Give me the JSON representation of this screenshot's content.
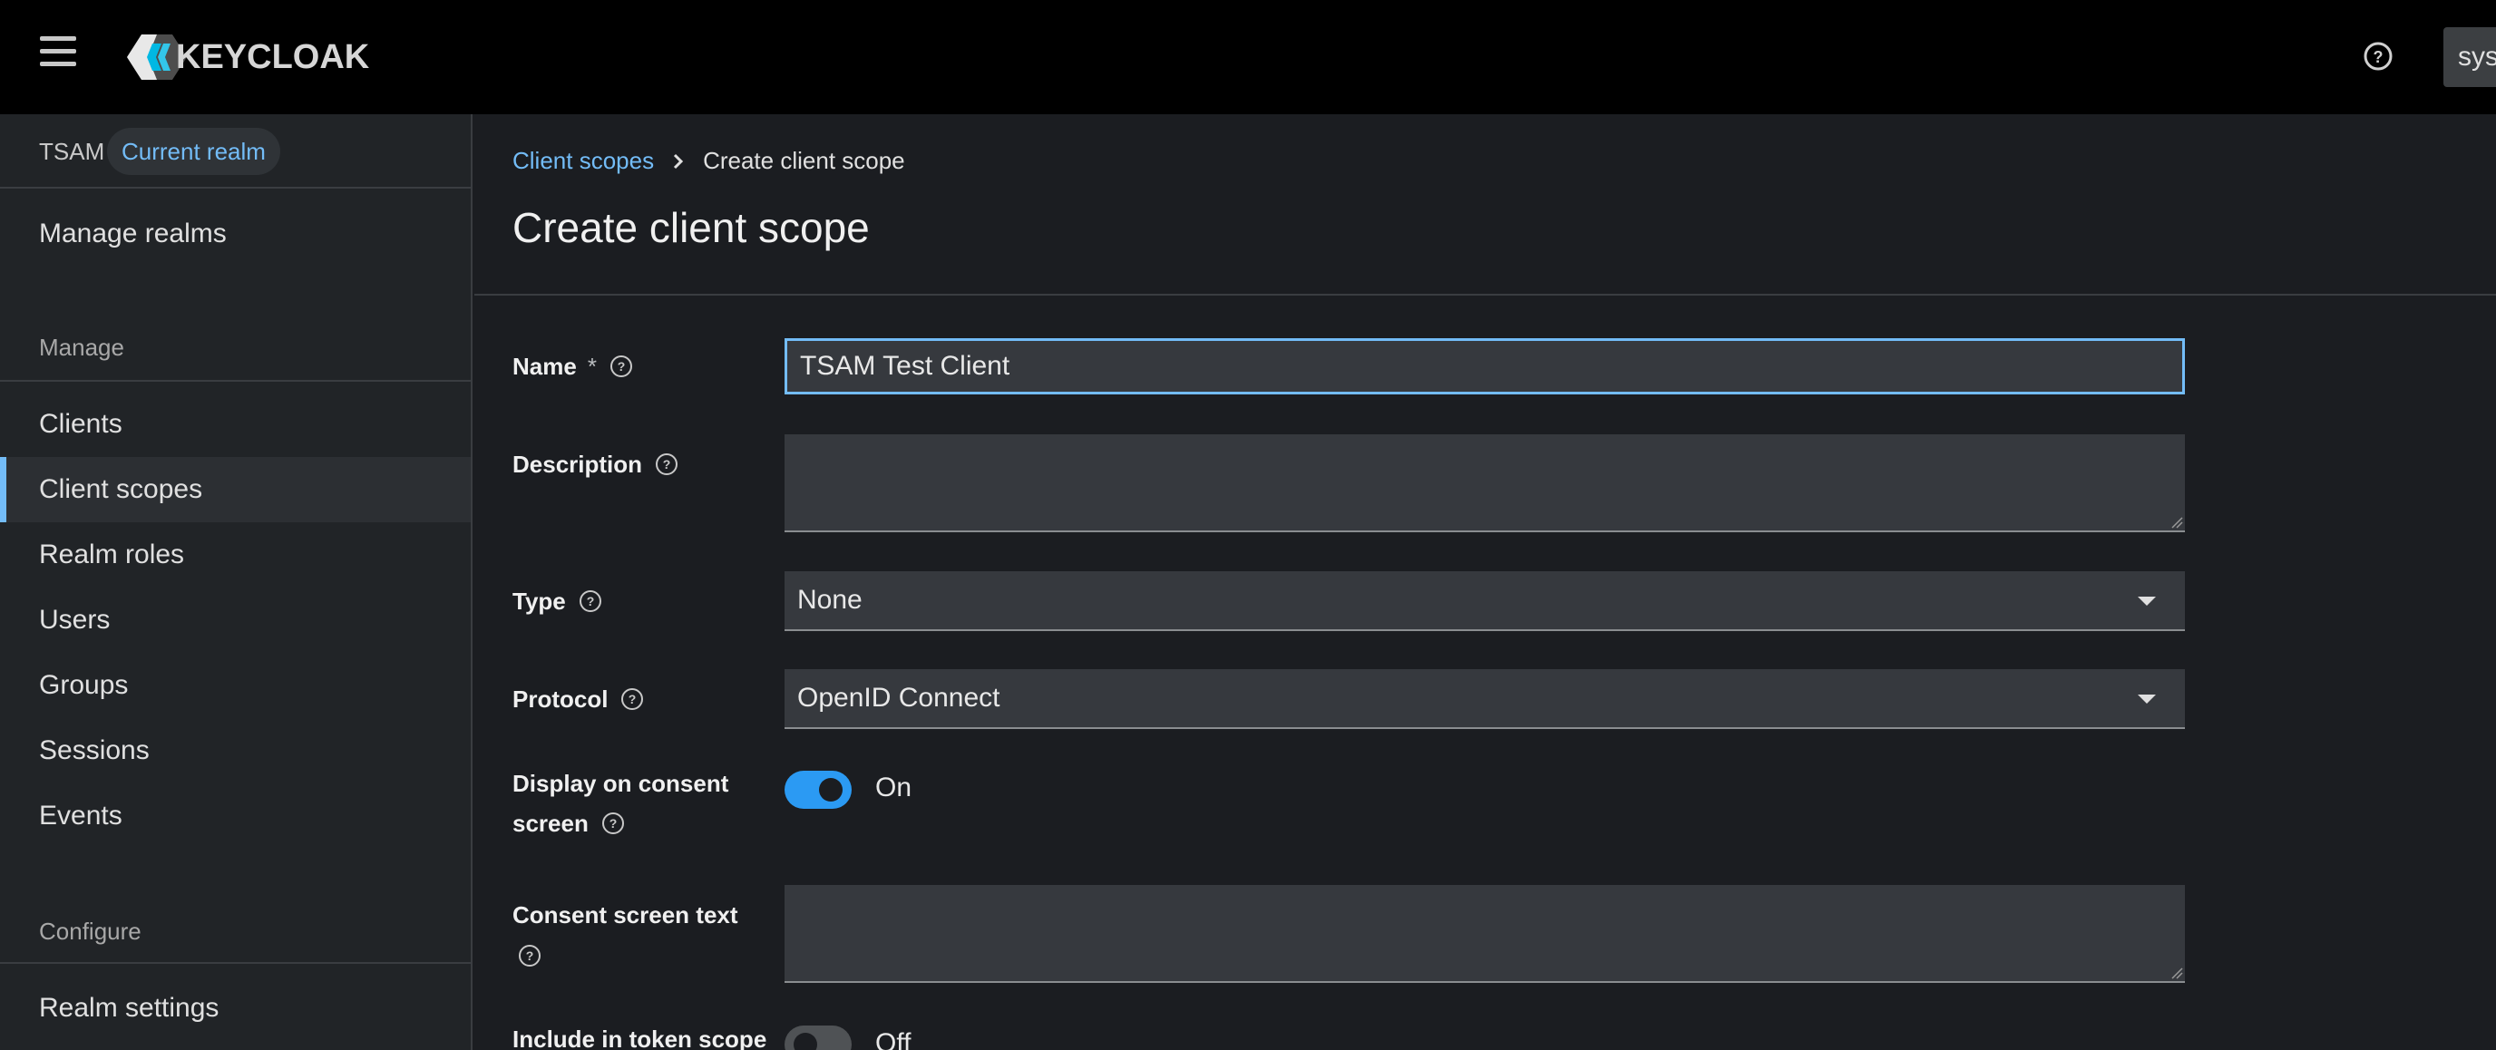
{
  "app": {
    "brand": "KEYCLOAK",
    "user_label": "syst"
  },
  "sidebar": {
    "realm_name": "TSAM",
    "realm_badge": "Current realm",
    "manage_realms": "Manage realms",
    "sections": [
      {
        "title": "Manage",
        "items": [
          {
            "label": "Clients"
          },
          {
            "label": "Client scopes"
          },
          {
            "label": "Realm roles"
          },
          {
            "label": "Users"
          },
          {
            "label": "Groups"
          },
          {
            "label": "Sessions"
          },
          {
            "label": "Events"
          }
        ]
      },
      {
        "title": "Configure",
        "items": [
          {
            "label": "Realm settings"
          }
        ]
      }
    ],
    "active_item": "Client scopes"
  },
  "breadcrumb": {
    "parent": "Client scopes",
    "current": "Create client scope"
  },
  "page": {
    "title": "Create client scope"
  },
  "form": {
    "name": {
      "label": "Name",
      "required_mark": "*",
      "value": "TSAM Test Client"
    },
    "description": {
      "label": "Description",
      "value": ""
    },
    "type": {
      "label": "Type",
      "value": "None"
    },
    "protocol": {
      "label": "Protocol",
      "value": "OpenID Connect"
    },
    "display_on_consent": {
      "label_line1": "Display on consent",
      "label_line2": "screen",
      "state": "On"
    },
    "consent_text": {
      "label": "Consent screen text",
      "value": ""
    },
    "include_in_token_scope": {
      "label": "Include in token scope",
      "state": "Off"
    }
  },
  "colors": {
    "accent": "#73bcf7",
    "toggle_on": "#2b9af3",
    "masthead": "#000000",
    "background": "#1b1d21"
  }
}
